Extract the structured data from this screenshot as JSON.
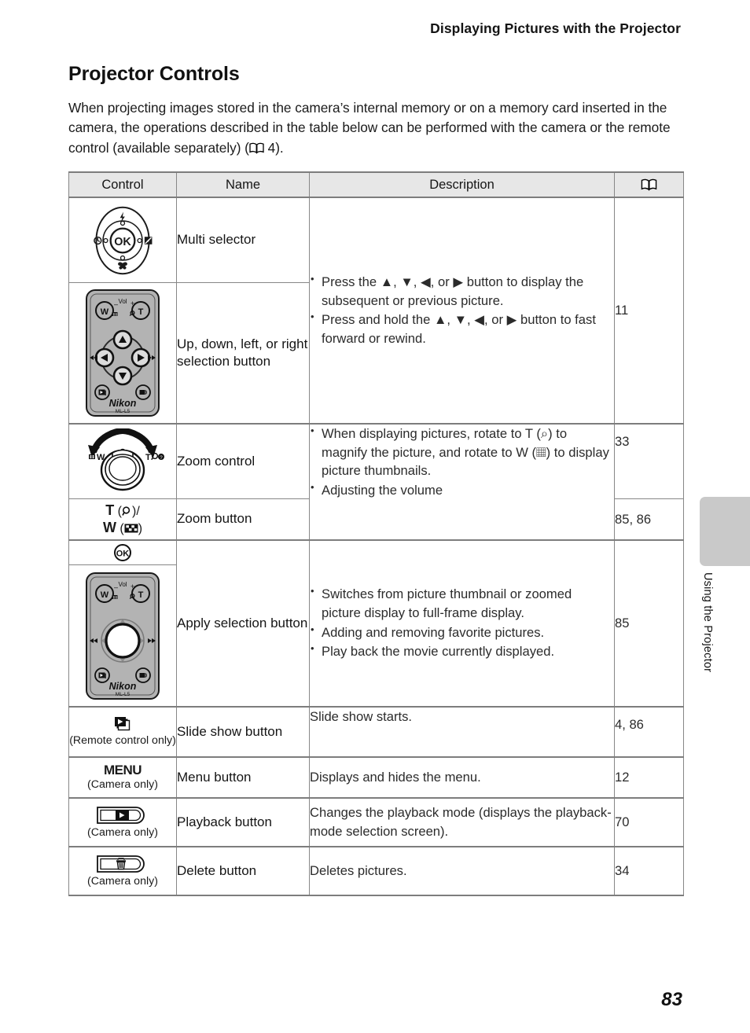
{
  "header": {
    "running_title": "Displaying Pictures with the Projector"
  },
  "page": {
    "number": "83",
    "side_tab_label": "Using the Projector"
  },
  "section": {
    "title": "Projector Controls",
    "intro": "When projecting images stored in the camera’s internal memory or on a memory card inserted in the camera, the operations described in the table below can be performed with the camera or the remote control (available separately) (",
    "intro_ref": " 4)."
  },
  "table": {
    "headers": {
      "control": "Control",
      "name": "Name",
      "description": "Description",
      "page_ref": "book-icon"
    },
    "rows": [
      {
        "control_icon": "multi-selector-dial",
        "control_caption": "",
        "name": "Multi selector",
        "description_bullets": [],
        "page_ref": ""
      },
      {
        "control_icon": "remote-control-dpad",
        "control_caption": "",
        "name": "Up, down, left, or right selection button",
        "description_bullets": [
          "Press the ▲, ▼, ◀, or ▶ button to display the subsequent or previous picture.",
          "Press and hold the ▲, ▼, ◀, or ▶ button to fast forward or rewind."
        ],
        "page_ref": "11"
      },
      {
        "control_icon": "zoom-control-ring",
        "control_caption": "",
        "name": "Zoom control",
        "description_bullets": [
          "When displaying pictures, rotate to T (⌕) to magnify the picture, and rotate to W (▦) to display picture thumbnails.",
          "Adjusting the volume"
        ],
        "page_ref": "33"
      },
      {
        "control_icon": "zoom-button-tw",
        "control_caption": "",
        "name": "Zoom button",
        "description_bullets": [],
        "page_ref": "85, 86"
      },
      {
        "control_icon": "ok-button-remote",
        "control_caption": "",
        "name": "Apply selection button",
        "description_bullets": [
          "Switches from picture thumbnail or zoomed picture display to full-frame display.",
          "Adding and removing favorite pictures.",
          "Play back the movie currently displayed."
        ],
        "page_ref": "85"
      },
      {
        "control_icon": "slide-show-icon",
        "control_caption": "(Remote control only)",
        "name": "Slide show button",
        "description_bullets": [
          "Slide show starts."
        ],
        "page_ref": "4, 86"
      },
      {
        "control_icon": "menu-icon",
        "control_caption": "(Camera only)",
        "name": "Menu button",
        "description_bullets": [
          "Displays and hides the menu."
        ],
        "page_ref": "12"
      },
      {
        "control_icon": "playback-button-icon",
        "control_caption": "(Camera only)",
        "name": "Playback button",
        "description_bullets": [
          "Changes the playback mode (displays the playback-mode selection screen)."
        ],
        "page_ref": "70"
      },
      {
        "control_icon": "delete-button-icon",
        "control_caption": "(Camera only)",
        "name": "Delete button",
        "description_bullets": [
          "Deletes pictures."
        ],
        "page_ref": "34"
      }
    ]
  },
  "remote": {
    "brand": "Nikon",
    "model": "ML-L5",
    "wide_label": "W",
    "tele_label": "T",
    "volume_label": "Vol",
    "minus_label": "−",
    "plus_label": "+"
  },
  "zoom_button": {
    "tele_line": "T",
    "wide_line": "W"
  },
  "menu_button": {
    "label": "MENU"
  },
  "zoom_control": {
    "left_label": "W",
    "right_label": "T"
  },
  "colors": {
    "rule": "#878787",
    "rule_thick": "#7d7d7d",
    "header_bg": "#e7e7e7",
    "tab_gray": "#c9c9c9",
    "remote_body": "#b3b3b3"
  }
}
